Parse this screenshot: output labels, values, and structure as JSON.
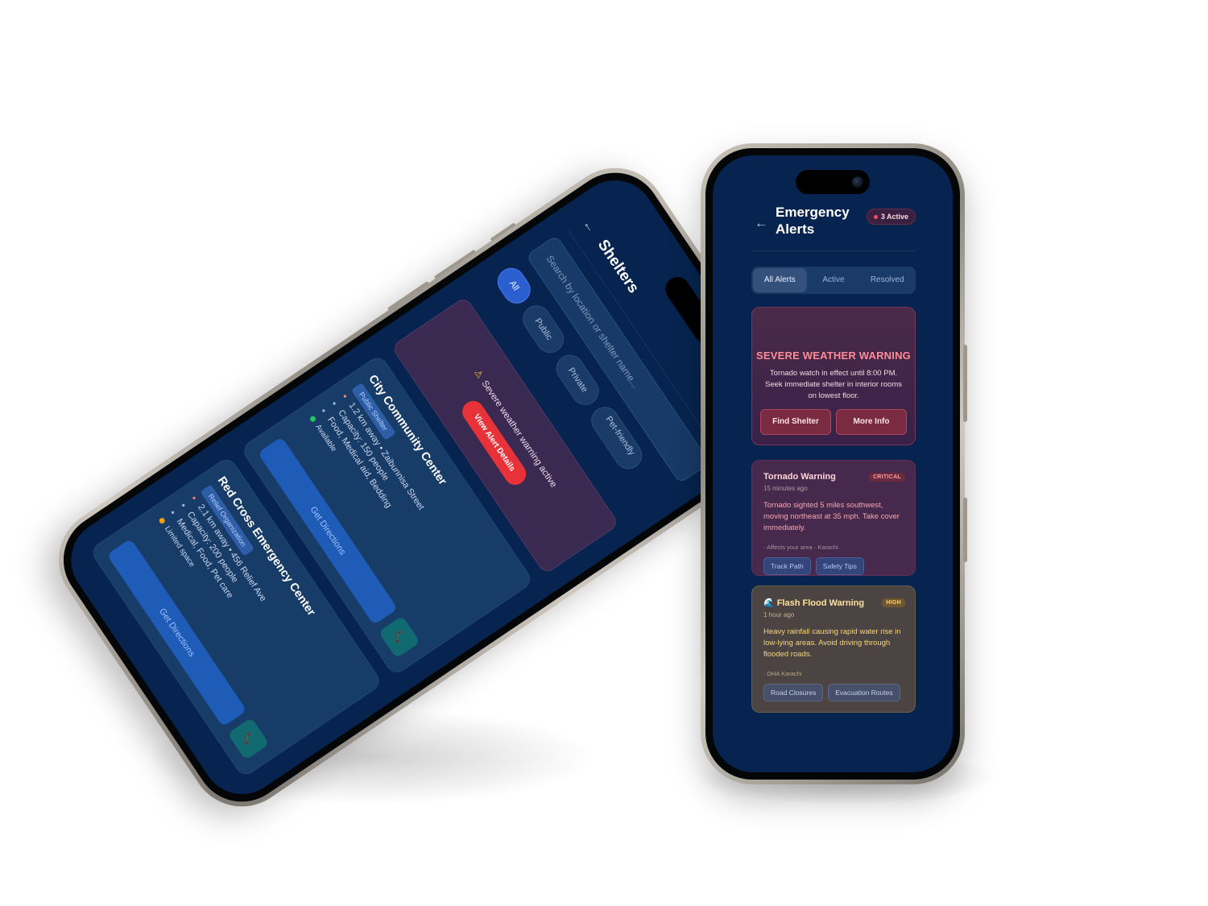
{
  "alerts_screen": {
    "back_icon": "←",
    "title": "Emergency Alerts",
    "active_badge": "3 Active",
    "tabs": [
      {
        "label": "All Alerts",
        "active": true
      },
      {
        "label": "Active",
        "active": false
      },
      {
        "label": "Resolved",
        "active": false
      }
    ],
    "hero": {
      "title": "SEVERE WEATHER WARNING",
      "text": "Tornado watch in effect until 8:00 PM. Seek immediate shelter in interior rooms on lowest floor.",
      "find_shelter": "Find Shelter",
      "more_info": "More Info"
    },
    "cards": [
      {
        "title": "Tornado Warning",
        "tag": "CRITICAL",
        "time": "15 minutes ago",
        "text": "Tornado sighted 5 miles southwest, moving northeast at 35 mph. Take cover immediately.",
        "location": "· Affects your area - Karachi",
        "chips": [
          "Track Path",
          "Safety Tips"
        ]
      },
      {
        "icon": "🌊",
        "title": "Flash Flood Warning",
        "tag": "HIGH",
        "time": "1 hour ago",
        "text": "Heavy rainfall causing rapid water rise in low-lying areas. Avoid driving through flooded roads.",
        "location": "· DHA Karachi",
        "chips": [
          "Road Closures",
          "Evacuation Routes"
        ]
      }
    ]
  },
  "shelters_screen": {
    "back_icon": "←",
    "title": "Shelters",
    "search_placeholder": "Search by location or shelter name...",
    "filters": [
      "All",
      "Public",
      "Private",
      "Pet-friendly"
    ],
    "warning": {
      "icon": "⚠",
      "text": "Severe weather warning active",
      "button": "View Alert Details"
    },
    "shelters": [
      {
        "name": "City Community Center",
        "type": "Public Shelter",
        "distance": "1.2 km away • Zaibunnisa Street",
        "capacity": "Capacity: 150 people",
        "services": "Food, Medical aid, Bedding",
        "status": "Available",
        "status_color": "#22c55e",
        "directions": "Get Directions",
        "call_icon": "📞"
      },
      {
        "name": "Red Cross Emergency Center",
        "type": "Relief Organization",
        "distance": "2.1 km away • 456 Relief Ave",
        "capacity": "Capacity: 200 people",
        "services": "Medical, Food, Pet care",
        "status": "Limited space",
        "status_color": "#f59e0b",
        "directions": "Get Directions",
        "call_icon": "📞"
      }
    ]
  }
}
